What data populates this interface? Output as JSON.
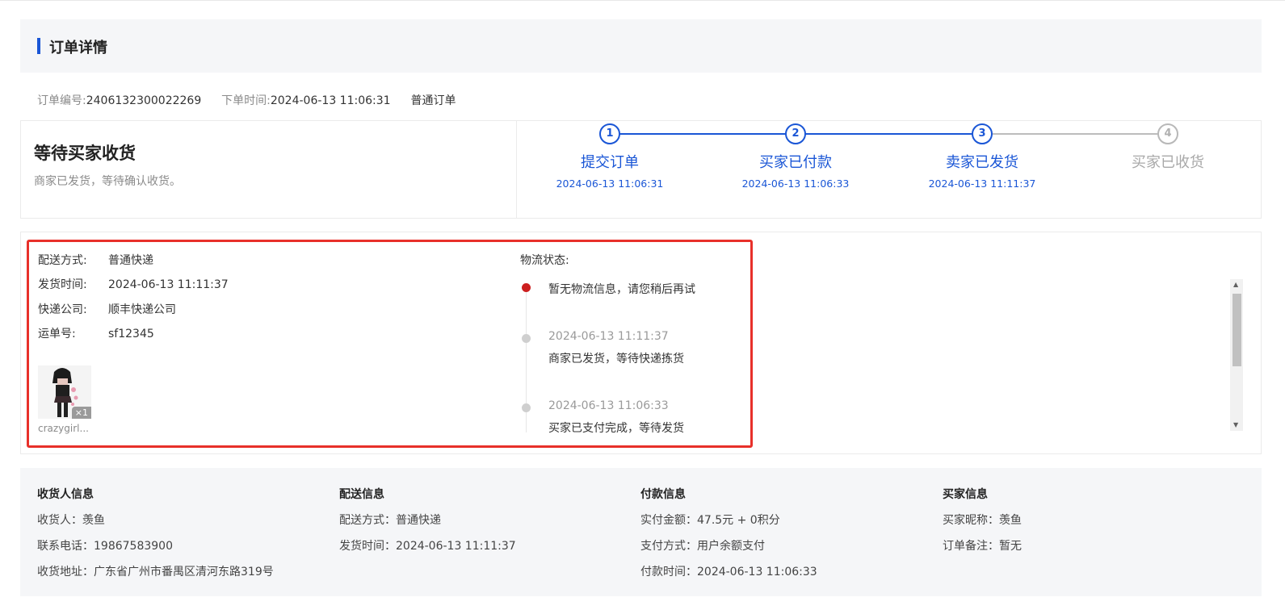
{
  "header": {
    "title": "订单详情"
  },
  "order_meta": {
    "order_no_label": "订单编号:",
    "order_no": "2406132300022269",
    "order_time_label": "下单时间:",
    "order_time": "2024-06-13 11:06:31",
    "order_type": "普通订单"
  },
  "status": {
    "title": "等待买家收货",
    "desc": "商家已发货，等待确认收货。"
  },
  "steps": [
    {
      "num": "1",
      "name": "提交订单",
      "time": "2024-06-13 11:06:31",
      "done": true
    },
    {
      "num": "2",
      "name": "买家已付款",
      "time": "2024-06-13 11:06:33",
      "done": true
    },
    {
      "num": "3",
      "name": "卖家已发货",
      "time": "2024-06-13 11:11:37",
      "done": true
    },
    {
      "num": "4",
      "name": "买家已收货",
      "time": "",
      "done": false
    }
  ],
  "shipping": {
    "rows": [
      {
        "label": "配送方式:",
        "value": "普通快递"
      },
      {
        "label": "发货时间:",
        "value": "2024-06-13 11:11:37"
      },
      {
        "label": "快递公司:",
        "value": "顺丰快递公司"
      },
      {
        "label": "运单号:",
        "value": "sf12345"
      }
    ],
    "product": {
      "name": "crazygirl...",
      "qty": "×1"
    }
  },
  "logistics": {
    "title": "物流状态:",
    "events": [
      {
        "time": "",
        "text": "暂无物流信息，请您稍后再试",
        "active": true
      },
      {
        "time": "2024-06-13 11:11:37",
        "text": "商家已发货，等待快递拣货",
        "active": false
      },
      {
        "time": "2024-06-13 11:06:33",
        "text": "买家已支付完成，等待发货",
        "active": false
      }
    ]
  },
  "colors": {
    "accent": "#1a56d6",
    "highlight": "#e8302a",
    "active_dot": "#cc1f1f"
  },
  "info_sections": [
    {
      "title": "收货人信息",
      "lines": [
        "收货人：羡鱼",
        "联系电话：19867583900",
        "收货地址：广东省广州市番禺区清河东路319号"
      ]
    },
    {
      "title": "配送信息",
      "lines": [
        "配送方式：普通快递",
        "发货时间：2024-06-13 11:11:37"
      ]
    },
    {
      "title": "付款信息",
      "lines": [
        "实付金额：47.5元 + 0积分",
        "支付方式：用户余额支付",
        "付款时间：2024-06-13 11:06:33"
      ]
    },
    {
      "title": "买家信息",
      "lines": [
        "买家昵称：羡鱼",
        "订单备注：暂无"
      ]
    }
  ]
}
